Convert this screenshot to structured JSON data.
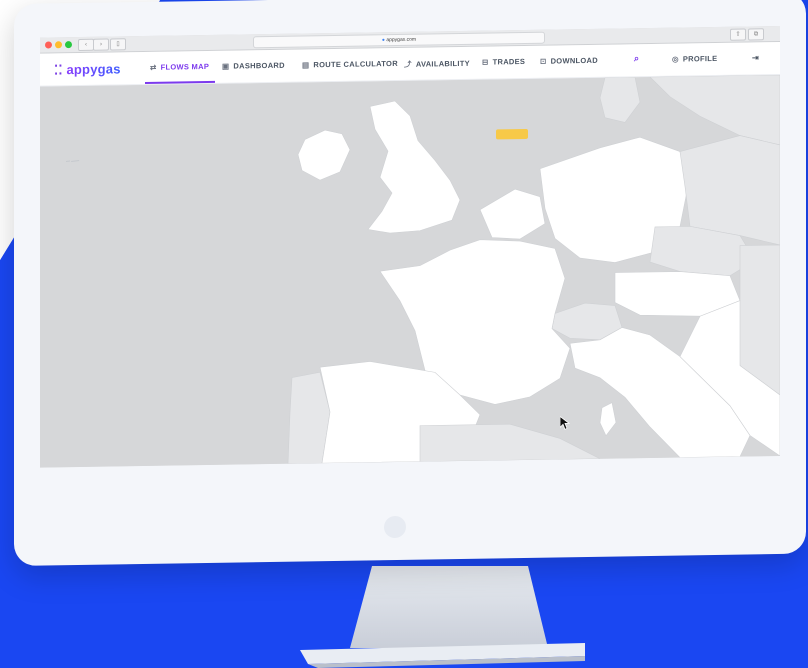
{
  "browser": {
    "url": "appygas.com"
  },
  "app": {
    "logo_text": "appygas",
    "nav": [
      {
        "id": "flows",
        "label": "FLOWS MAP",
        "icon": "flows-icon",
        "active": true
      },
      {
        "id": "dashboard",
        "label": "DASHBOARD",
        "icon": "dashboard-icon",
        "active": false
      },
      {
        "id": "route",
        "label": "ROUTE CALCULATOR",
        "icon": "calculator-icon",
        "active": false
      },
      {
        "id": "availability",
        "label": "AVAILABILITY",
        "icon": "availability-icon",
        "active": false
      },
      {
        "id": "trades",
        "label": "TRADES",
        "icon": "trades-icon",
        "active": false
      },
      {
        "id": "download",
        "label": "DOWNLOAD",
        "icon": "download-icon",
        "active": false
      }
    ],
    "search_icon": "search-icon",
    "profile_label": "PROFILE",
    "logout_icon": "logout-icon"
  },
  "colors": {
    "brand_blue": "#1a47f2",
    "accent_purple": "#7c3aed",
    "map_sea": "#d6d7d9",
    "map_land": "#ffffff",
    "map_other_land": "#e6e7e9",
    "marker_yellow": "#f7c948"
  }
}
